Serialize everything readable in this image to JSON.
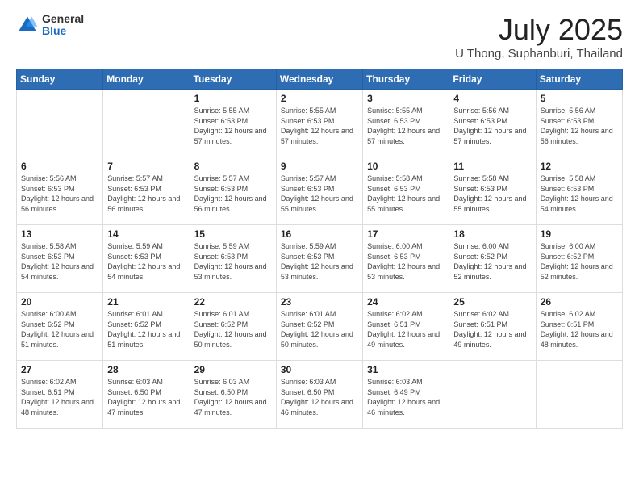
{
  "logo": {
    "general": "General",
    "blue": "Blue"
  },
  "header": {
    "month": "July 2025",
    "location": "U Thong, Suphanburi, Thailand"
  },
  "weekdays": [
    "Sunday",
    "Monday",
    "Tuesday",
    "Wednesday",
    "Thursday",
    "Friday",
    "Saturday"
  ],
  "weeks": [
    [
      {
        "day": "",
        "info": ""
      },
      {
        "day": "",
        "info": ""
      },
      {
        "day": "1",
        "info": "Sunrise: 5:55 AM\nSunset: 6:53 PM\nDaylight: 12 hours and 57 minutes."
      },
      {
        "day": "2",
        "info": "Sunrise: 5:55 AM\nSunset: 6:53 PM\nDaylight: 12 hours and 57 minutes."
      },
      {
        "day": "3",
        "info": "Sunrise: 5:55 AM\nSunset: 6:53 PM\nDaylight: 12 hours and 57 minutes."
      },
      {
        "day": "4",
        "info": "Sunrise: 5:56 AM\nSunset: 6:53 PM\nDaylight: 12 hours and 57 minutes."
      },
      {
        "day": "5",
        "info": "Sunrise: 5:56 AM\nSunset: 6:53 PM\nDaylight: 12 hours and 56 minutes."
      }
    ],
    [
      {
        "day": "6",
        "info": "Sunrise: 5:56 AM\nSunset: 6:53 PM\nDaylight: 12 hours and 56 minutes."
      },
      {
        "day": "7",
        "info": "Sunrise: 5:57 AM\nSunset: 6:53 PM\nDaylight: 12 hours and 56 minutes."
      },
      {
        "day": "8",
        "info": "Sunrise: 5:57 AM\nSunset: 6:53 PM\nDaylight: 12 hours and 56 minutes."
      },
      {
        "day": "9",
        "info": "Sunrise: 5:57 AM\nSunset: 6:53 PM\nDaylight: 12 hours and 55 minutes."
      },
      {
        "day": "10",
        "info": "Sunrise: 5:58 AM\nSunset: 6:53 PM\nDaylight: 12 hours and 55 minutes."
      },
      {
        "day": "11",
        "info": "Sunrise: 5:58 AM\nSunset: 6:53 PM\nDaylight: 12 hours and 55 minutes."
      },
      {
        "day": "12",
        "info": "Sunrise: 5:58 AM\nSunset: 6:53 PM\nDaylight: 12 hours and 54 minutes."
      }
    ],
    [
      {
        "day": "13",
        "info": "Sunrise: 5:58 AM\nSunset: 6:53 PM\nDaylight: 12 hours and 54 minutes."
      },
      {
        "day": "14",
        "info": "Sunrise: 5:59 AM\nSunset: 6:53 PM\nDaylight: 12 hours and 54 minutes."
      },
      {
        "day": "15",
        "info": "Sunrise: 5:59 AM\nSunset: 6:53 PM\nDaylight: 12 hours and 53 minutes."
      },
      {
        "day": "16",
        "info": "Sunrise: 5:59 AM\nSunset: 6:53 PM\nDaylight: 12 hours and 53 minutes."
      },
      {
        "day": "17",
        "info": "Sunrise: 6:00 AM\nSunset: 6:53 PM\nDaylight: 12 hours and 53 minutes."
      },
      {
        "day": "18",
        "info": "Sunrise: 6:00 AM\nSunset: 6:52 PM\nDaylight: 12 hours and 52 minutes."
      },
      {
        "day": "19",
        "info": "Sunrise: 6:00 AM\nSunset: 6:52 PM\nDaylight: 12 hours and 52 minutes."
      }
    ],
    [
      {
        "day": "20",
        "info": "Sunrise: 6:00 AM\nSunset: 6:52 PM\nDaylight: 12 hours and 51 minutes."
      },
      {
        "day": "21",
        "info": "Sunrise: 6:01 AM\nSunset: 6:52 PM\nDaylight: 12 hours and 51 minutes."
      },
      {
        "day": "22",
        "info": "Sunrise: 6:01 AM\nSunset: 6:52 PM\nDaylight: 12 hours and 50 minutes."
      },
      {
        "day": "23",
        "info": "Sunrise: 6:01 AM\nSunset: 6:52 PM\nDaylight: 12 hours and 50 minutes."
      },
      {
        "day": "24",
        "info": "Sunrise: 6:02 AM\nSunset: 6:51 PM\nDaylight: 12 hours and 49 minutes."
      },
      {
        "day": "25",
        "info": "Sunrise: 6:02 AM\nSunset: 6:51 PM\nDaylight: 12 hours and 49 minutes."
      },
      {
        "day": "26",
        "info": "Sunrise: 6:02 AM\nSunset: 6:51 PM\nDaylight: 12 hours and 48 minutes."
      }
    ],
    [
      {
        "day": "27",
        "info": "Sunrise: 6:02 AM\nSunset: 6:51 PM\nDaylight: 12 hours and 48 minutes."
      },
      {
        "day": "28",
        "info": "Sunrise: 6:03 AM\nSunset: 6:50 PM\nDaylight: 12 hours and 47 minutes."
      },
      {
        "day": "29",
        "info": "Sunrise: 6:03 AM\nSunset: 6:50 PM\nDaylight: 12 hours and 47 minutes."
      },
      {
        "day": "30",
        "info": "Sunrise: 6:03 AM\nSunset: 6:50 PM\nDaylight: 12 hours and 46 minutes."
      },
      {
        "day": "31",
        "info": "Sunrise: 6:03 AM\nSunset: 6:49 PM\nDaylight: 12 hours and 46 minutes."
      },
      {
        "day": "",
        "info": ""
      },
      {
        "day": "",
        "info": ""
      }
    ]
  ]
}
